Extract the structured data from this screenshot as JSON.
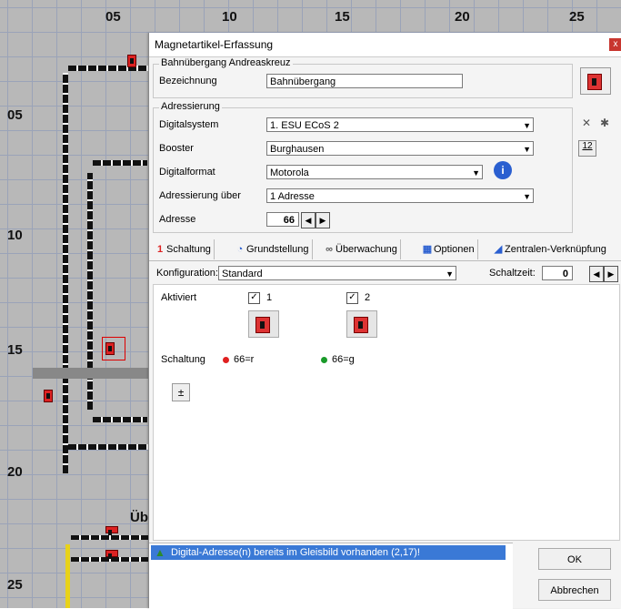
{
  "grid": {
    "col_labels": [
      "05",
      "10",
      "15",
      "20",
      "25"
    ],
    "row_labels": [
      "05",
      "10",
      "15",
      "20",
      "25"
    ],
    "partial_label": "Üb"
  },
  "dialog": {
    "title": "Magnetartikel-Erfassung",
    "close": "x",
    "group1": {
      "title": "Bahnübergang Andreaskreuz",
      "bezeichnung_label": "Bezeichnung",
      "bezeichnung_value": "Bahnübergang"
    },
    "group2": {
      "title": "Adressierung",
      "digitalsystem_label": "Digitalsystem",
      "digitalsystem_value": "1. ESU ECoS 2",
      "booster_label": "Booster",
      "booster_value": "Burghausen",
      "digitalformat_label": "Digitalformat",
      "digitalformat_value": "Motorola",
      "adressierung_label": "Adressierung über",
      "adressierung_value": "1 Adresse",
      "adresse_label": "Adresse",
      "adresse_value": "66",
      "icon_12": "12"
    },
    "tabs": [
      {
        "icon": "1/2",
        "label": "Schaltung"
      },
      {
        "icon": "G",
        "label": "Grundstellung"
      },
      {
        "icon": "Ü",
        "label": "Überwachung"
      },
      {
        "icon": "O",
        "label": "Optionen"
      },
      {
        "icon": "Z",
        "label": "Zentralen-Verknüpfung"
      }
    ],
    "konfiguration_label": "Konfiguration:",
    "konfiguration_value": "Standard",
    "schaltzeit_label": "Schaltzeit:",
    "schaltzeit_value": "0",
    "aktiviert_label": "Aktiviert",
    "check1": "1",
    "check2": "2",
    "schaltung_label": "Schaltung",
    "out1": "66=r",
    "out2": "66=g",
    "status_message": "Digital-Adresse(n) bereits im Gleisbild vorhanden (2,17)!",
    "ok": "OK",
    "cancel": "Abbrechen"
  },
  "colors": {
    "red": "#e02020",
    "green": "#1a9a2a",
    "selection": "#3a79d6"
  }
}
